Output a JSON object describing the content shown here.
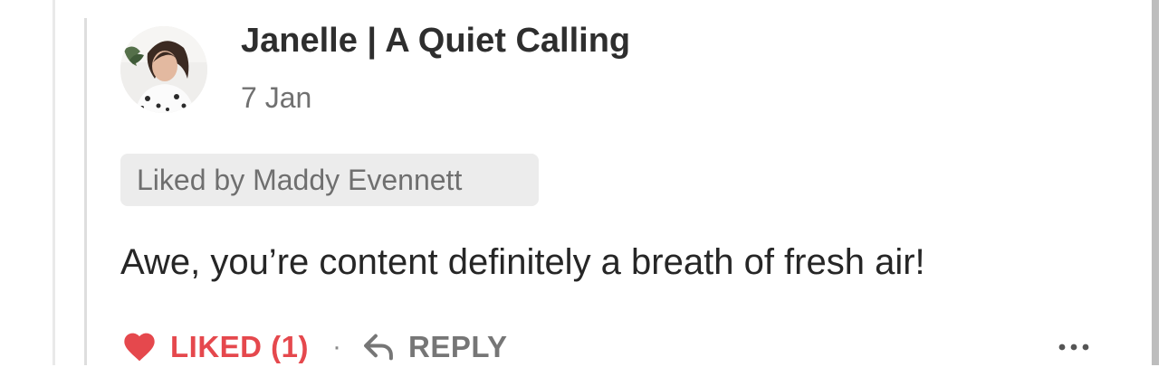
{
  "comment": {
    "author": "Janelle | A Quiet Calling",
    "date": "7  Jan",
    "liked_by": "Liked by Maddy Evennett",
    "body": "Awe, you’re content definitely a breath of fresh air!"
  },
  "actions": {
    "like_label": "LIKED (1)",
    "separator": "·",
    "reply_label": "REPLY"
  },
  "icons": {
    "like": "heart-icon",
    "reply": "reply-arrow-icon",
    "more": "more-dots-icon"
  },
  "colors": {
    "liked_red": "#e5484d",
    "muted_gray": "#767676",
    "badge_bg": "#ececec"
  }
}
